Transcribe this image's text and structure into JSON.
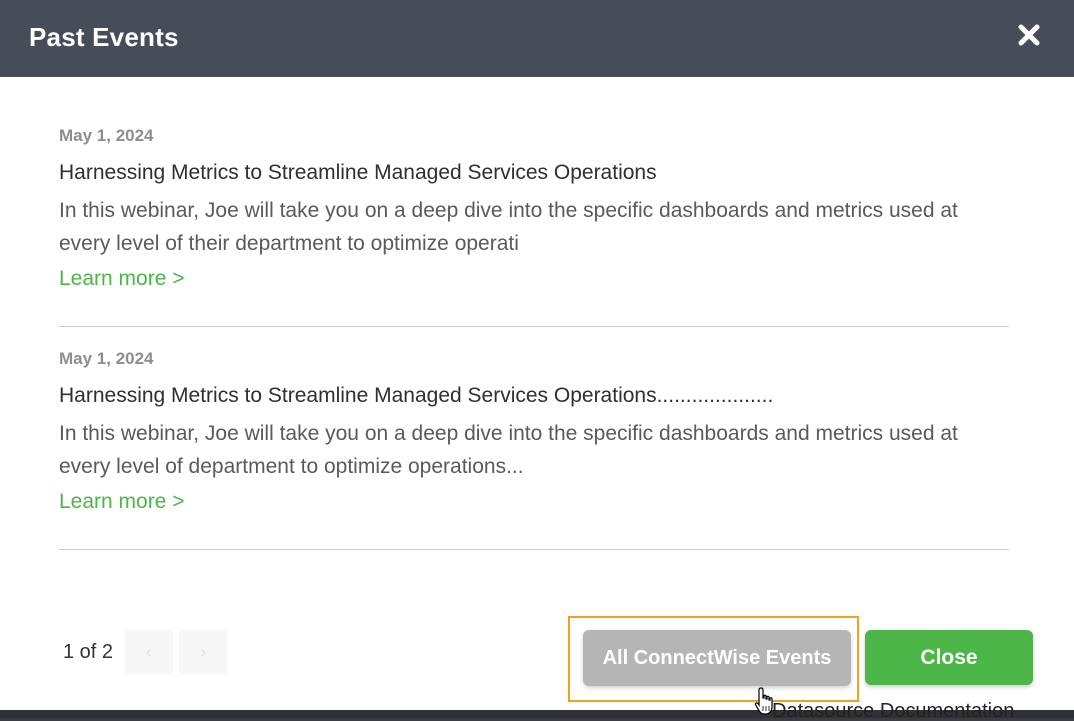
{
  "modal": {
    "title": "Past Events",
    "close_icon": "close-x-icon"
  },
  "events": [
    {
      "date": "May 1, 2024",
      "title": "Harnessing Metrics to Streamline Managed Services Operations",
      "description": "In this webinar, Joe will take you on a deep dive into the specific dashboards and metrics used at every level of their department to optimize operati",
      "link": "Learn more >"
    },
    {
      "date": "May 1, 2024",
      "title": "Harnessing Metrics to Streamline Managed Services Operations....................",
      "description": "In this webinar, Joe will take you on a deep dive into the specific dashboards and metrics used at every level of department to optimize operations...",
      "link": "Learn more >"
    }
  ],
  "pagination": {
    "label": "1 of 2",
    "prev_icon": "chevron-left-icon",
    "next_icon": "chevron-right-icon"
  },
  "footer": {
    "all_events_label": "All ConnectWise Events",
    "close_label": "Close"
  },
  "background": {
    "partial_text": "Datasource Documentation"
  },
  "colors": {
    "header": "#474d58",
    "accent_green": "#4cb648",
    "highlight": "#f0a21e",
    "button_gray": "#b5b5b5"
  }
}
